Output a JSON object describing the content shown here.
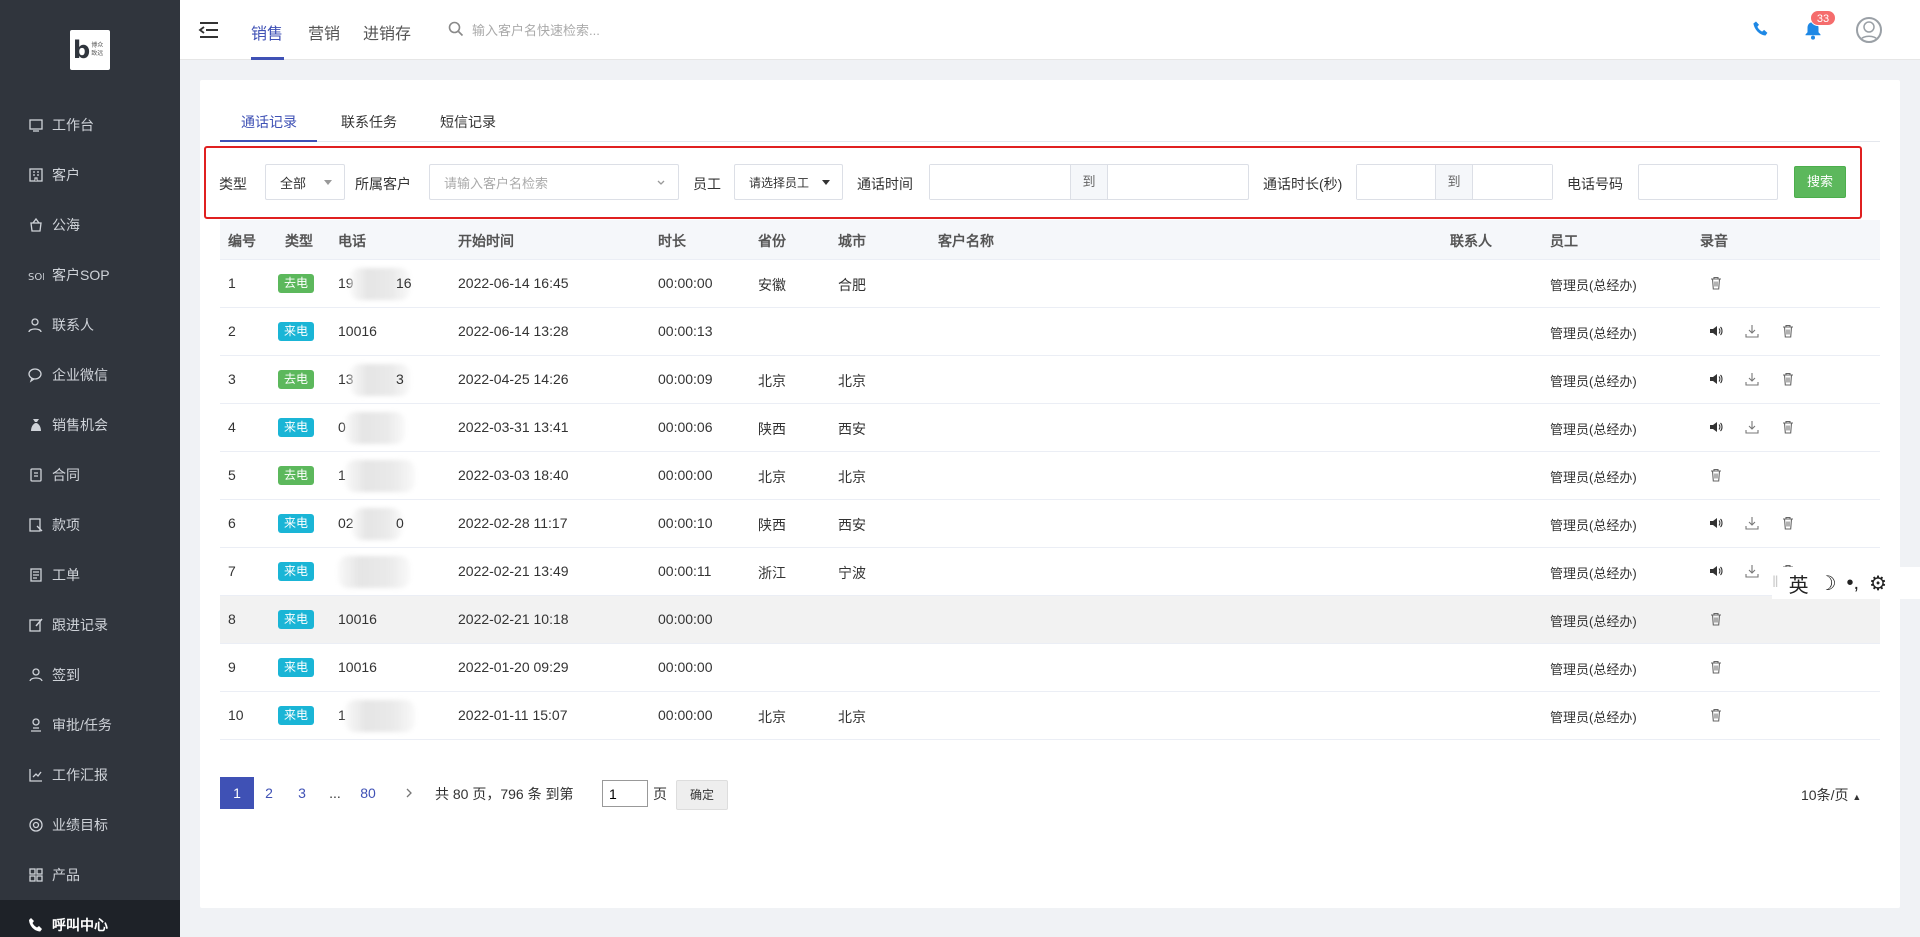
{
  "logo": {
    "letter": "b",
    "text": "博众 致远"
  },
  "sidebar": {
    "items": [
      {
        "label": "工作台",
        "icon": "dashboard-icon"
      },
      {
        "label": "客户",
        "icon": "building-icon"
      },
      {
        "label": "公海",
        "icon": "ocean-icon"
      },
      {
        "label": "客户SOP",
        "icon": "sop-icon"
      },
      {
        "label": "联系人",
        "icon": "contacts-icon"
      },
      {
        "label": "企业微信",
        "icon": "wechat-icon"
      },
      {
        "label": "销售机会",
        "icon": "money-bag-icon"
      },
      {
        "label": "合同",
        "icon": "contract-icon"
      },
      {
        "label": "款项",
        "icon": "payment-icon"
      },
      {
        "label": "工单",
        "icon": "ticket-icon"
      },
      {
        "label": "跟进记录",
        "icon": "edit-icon"
      },
      {
        "label": "签到",
        "icon": "location-icon"
      },
      {
        "label": "审批/任务",
        "icon": "approval-icon"
      },
      {
        "label": "工作汇报",
        "icon": "report-icon"
      },
      {
        "label": "业绩目标",
        "icon": "target-icon"
      },
      {
        "label": "产品",
        "icon": "grid-icon"
      },
      {
        "label": "呼叫中心",
        "icon": "phone-icon"
      }
    ]
  },
  "header": {
    "nav": [
      "销售",
      "营销",
      "进销存"
    ],
    "search_placeholder": "输入客户名快速检索...",
    "notification_count": "33"
  },
  "tabs": [
    "通话记录",
    "联系任务",
    "短信记录"
  ],
  "filter": {
    "type_label": "类型",
    "type_value": "全部",
    "customer_label": "所属客户",
    "customer_placeholder": "请输入客户名检索",
    "employee_label": "员工",
    "employee_value": "请选择员工",
    "time_label": "通话时间",
    "to": "到",
    "duration_label": "通话时长(秒)",
    "phone_label": "电话号码",
    "search_button": "搜索"
  },
  "table": {
    "headers": [
      "编号",
      "类型",
      "电话",
      "开始时间",
      "时长",
      "省份",
      "城市",
      "客户名称",
      "联系人",
      "员工",
      "录音"
    ],
    "rows": [
      {
        "no": "1",
        "type": "去电",
        "phone_a": "19",
        "phone_b": "16",
        "start": "2022-06-14 16:45",
        "duration": "00:00:00",
        "province": "安徽",
        "city": "合肥",
        "employee": "管理员(总经办)",
        "recording": false
      },
      {
        "no": "2",
        "type": "来电",
        "phone_a": "10016",
        "phone_b": "",
        "start": "2022-06-14 13:28",
        "duration": "00:00:13",
        "province": "",
        "city": "",
        "employee": "管理员(总经办)",
        "recording": true
      },
      {
        "no": "3",
        "type": "去电",
        "phone_a": "13",
        "phone_b": "3",
        "start": "2022-04-25 14:26",
        "duration": "00:00:09",
        "province": "北京",
        "city": "北京",
        "employee": "管理员(总经办)",
        "recording": true
      },
      {
        "no": "4",
        "type": "来电",
        "phone_a": "0",
        "phone_b": "",
        "start": "2022-03-31 13:41",
        "duration": "00:00:06",
        "province": "陕西",
        "city": "西安",
        "employee": "管理员(总经办)",
        "recording": true
      },
      {
        "no": "5",
        "type": "去电",
        "phone_a": "1",
        "phone_b": "",
        "start": "2022-03-03 18:40",
        "duration": "00:00:00",
        "province": "北京",
        "city": "北京",
        "employee": "管理员(总经办)",
        "recording": false
      },
      {
        "no": "6",
        "type": "来电",
        "phone_a": "02",
        "phone_b": "0",
        "start": "2022-02-28 11:17",
        "duration": "00:00:10",
        "province": "陕西",
        "city": "西安",
        "employee": "管理员(总经办)",
        "recording": true
      },
      {
        "no": "7",
        "type": "来电",
        "phone_a": "",
        "phone_b": "",
        "start": "2022-02-21 13:49",
        "duration": "00:00:11",
        "province": "浙江",
        "city": "宁波",
        "employee": "管理员(总经办)",
        "recording": true
      },
      {
        "no": "8",
        "type": "来电",
        "phone_a": "10016",
        "phone_b": "",
        "start": "2022-02-21 10:18",
        "duration": "00:00:00",
        "province": "",
        "city": "",
        "employee": "管理员(总经办)",
        "recording": false
      },
      {
        "no": "9",
        "type": "来电",
        "phone_a": "10016",
        "phone_b": "",
        "start": "2022-01-20 09:29",
        "duration": "00:00:00",
        "province": "",
        "city": "",
        "employee": "管理员(总经办)",
        "recording": false
      },
      {
        "no": "10",
        "type": "来电",
        "phone_a": "1",
        "phone_b": "",
        "start": "2022-01-11 15:07",
        "duration": "00:00:00",
        "province": "北京",
        "city": "北京",
        "employee": "管理员(总经办)",
        "recording": false
      }
    ]
  },
  "pagination": {
    "pages": [
      "1",
      "2",
      "3",
      "...",
      "80"
    ],
    "summary_before": "共 80 页，796 条 到第",
    "goto_value": "1",
    "page_unit": "页",
    "confirm": "确定",
    "page_size": "10条/页"
  },
  "ime": {
    "lang": "英",
    "moon": "☽",
    "punct": "•,",
    "gear": "⚙"
  },
  "colors": {
    "accent": "#3f51b5",
    "outgoing": "#5cb85c",
    "incoming": "#1ab5d6",
    "sidebar": "#30353d",
    "search_button": "#5cb85c",
    "highlight_border": "#e02020"
  }
}
